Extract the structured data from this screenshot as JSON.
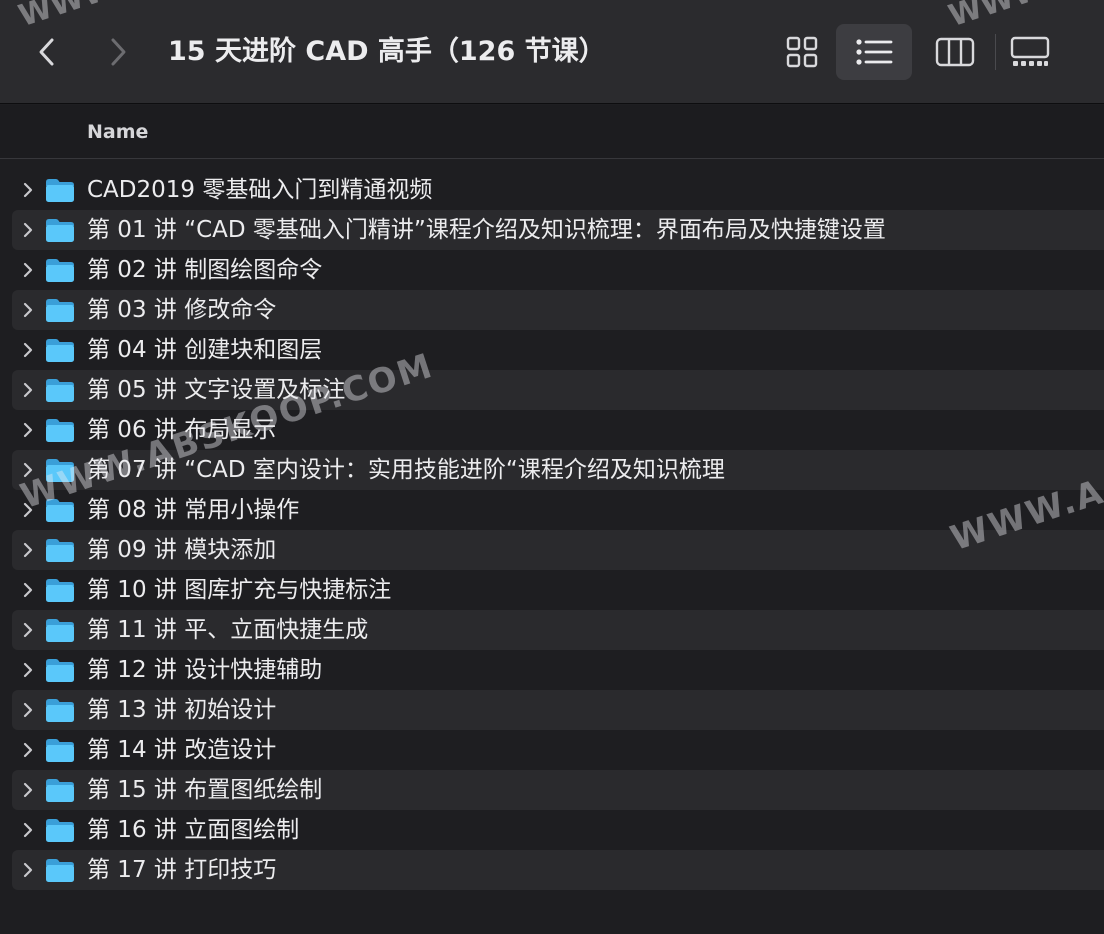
{
  "window": {
    "title": "15 天进阶 CAD 高手（126 节课）"
  },
  "toolbar": {
    "back_icon": "chevron-left-icon",
    "forward_icon": "chevron-right-icon",
    "view_modes": [
      "icon-grid-icon",
      "list-view-icon",
      "column-view-icon",
      "gallery-view-icon"
    ],
    "selected_view": "list-view-icon"
  },
  "header": {
    "name_label": "Name"
  },
  "colors": {
    "folder": "#5ac8fa",
    "background": "#1e1e21",
    "toolbar": "#2b2b2e",
    "row_alt": "#2a2a2d"
  },
  "items": [
    {
      "label": "CAD2019 零基础入门到精通视频"
    },
    {
      "label": "第 01 讲 “CAD 零基础入门精讲”课程介绍及知识梳理：界面布局及快捷键设置"
    },
    {
      "label": "第 02 讲 制图绘图命令"
    },
    {
      "label": "第 03 讲 修改命令"
    },
    {
      "label": "第 04 讲 创建块和图层"
    },
    {
      "label": "第 05 讲 文字设置及标注"
    },
    {
      "label": "第 06 讲 布局显示"
    },
    {
      "label": "第 07 讲 “CAD 室内设计：实用技能进阶“课程介绍及知识梳理"
    },
    {
      "label": "第 08 讲 常用小操作"
    },
    {
      "label": "第 09 讲 模块添加"
    },
    {
      "label": "第 10 讲 图库扩充与快捷标注"
    },
    {
      "label": "第 11 讲 平、立面快捷生成"
    },
    {
      "label": "第 12 讲 设计快捷辅助"
    },
    {
      "label": "第 13 讲 初始设计"
    },
    {
      "label": "第 14 讲 改造设计"
    },
    {
      "label": "第 15 讲 布置图纸绘制"
    },
    {
      "label": "第 16 讲 立面图绘制"
    },
    {
      "label": "第 17 讲 打印技巧"
    }
  ],
  "watermark": {
    "main": "WWW.ABSKOOP.COM",
    "right": "WWW.A",
    "top_left": "WWW",
    "top_right": "WWW"
  }
}
